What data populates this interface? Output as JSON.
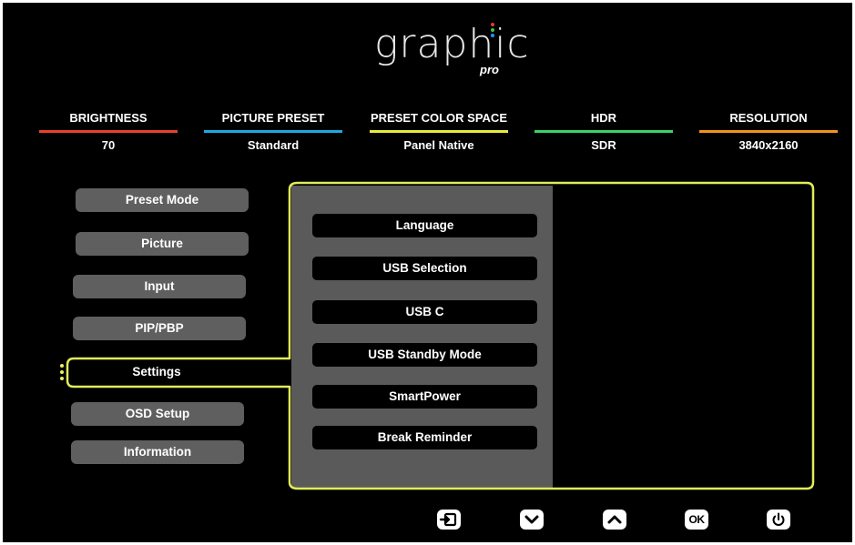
{
  "logo": {
    "word": "graphic",
    "sub": "pro",
    "dot_colors": [
      "#e53935",
      "#43c443",
      "#2196f3"
    ]
  },
  "status": [
    {
      "label": "BRIGHTNESS",
      "value": "70",
      "color": "#e8412e"
    },
    {
      "label": "PICTURE PRESET",
      "value": "Standard",
      "color": "#1ea9e1"
    },
    {
      "label": "PRESET COLOR SPACE",
      "value": "Panel Native",
      "color": "#e8eb3c"
    },
    {
      "label": "HDR",
      "value": "SDR",
      "color": "#37d36a"
    },
    {
      "label": "RESOLUTION",
      "value": "3840x2160",
      "color": "#f5921e"
    }
  ],
  "menu": {
    "items": [
      {
        "label": "Preset Mode"
      },
      {
        "label": "Picture"
      },
      {
        "label": "Input"
      },
      {
        "label": "PIP/PBP"
      },
      {
        "label": "Settings"
      },
      {
        "label": "OSD Setup"
      },
      {
        "label": "Information"
      }
    ],
    "selected": "Settings"
  },
  "submenu": {
    "items": [
      {
        "label": "Language"
      },
      {
        "label": "USB Selection"
      },
      {
        "label": "USB C"
      },
      {
        "label": "USB Standby Mode"
      },
      {
        "label": "SmartPower"
      },
      {
        "label": "Break Reminder"
      }
    ]
  },
  "bottom_buttons": [
    {
      "icon": "exit-icon"
    },
    {
      "icon": "chevron-down-icon"
    },
    {
      "icon": "chevron-up-icon"
    },
    {
      "label": "OK",
      "icon": "ok-icon"
    },
    {
      "icon": "power-icon"
    }
  ],
  "colors": {
    "accent_outline": "#e2ec57",
    "menu_button": "#5f5f5f",
    "panel_gray": "#5a5a5a",
    "background": "#000000"
  }
}
